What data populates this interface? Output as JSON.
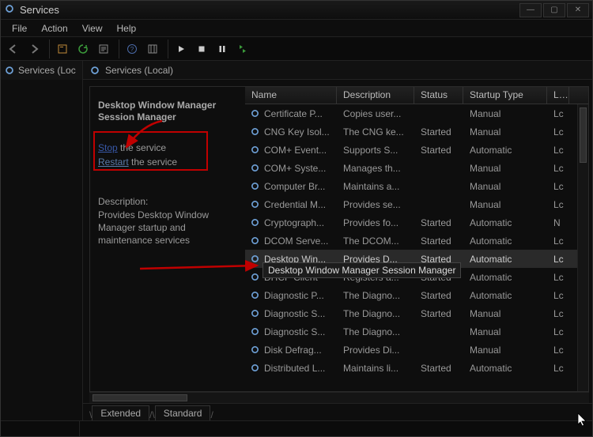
{
  "window": {
    "title": "Services"
  },
  "menu": {
    "file": "File",
    "action": "Action",
    "view": "View",
    "help": "Help"
  },
  "panes": {
    "left_header": "Services (Loc",
    "right_header": "Services (Local)"
  },
  "detail": {
    "service_name": "Desktop Window Manager Session Manager",
    "stop_link": "Stop",
    "stop_suffix": " the service",
    "restart_link": "Restart",
    "restart_suffix": " the service",
    "desc_label": "Description:",
    "desc_text": "Provides Desktop Window Manager startup and maintenance services"
  },
  "grid": {
    "headers": {
      "name": "Name",
      "desc": "Description",
      "status": "Status",
      "startup": "Startup Type",
      "logon": "Lo"
    },
    "rows": [
      {
        "name": "Certificate P...",
        "desc": "Copies user...",
        "status": "",
        "startup": "Manual",
        "logon": "Lc"
      },
      {
        "name": "CNG Key Isol...",
        "desc": "The CNG ke...",
        "status": "Started",
        "startup": "Manual",
        "logon": "Lc"
      },
      {
        "name": "COM+ Event...",
        "desc": "Supports S...",
        "status": "Started",
        "startup": "Automatic",
        "logon": "Lc"
      },
      {
        "name": "COM+ Syste...",
        "desc": "Manages th...",
        "status": "",
        "startup": "Manual",
        "logon": "Lc"
      },
      {
        "name": "Computer Br...",
        "desc": "Maintains a...",
        "status": "",
        "startup": "Manual",
        "logon": "Lc"
      },
      {
        "name": "Credential M...",
        "desc": "Provides se...",
        "status": "",
        "startup": "Manual",
        "logon": "Lc"
      },
      {
        "name": "Cryptograph...",
        "desc": "Provides fo...",
        "status": "Started",
        "startup": "Automatic",
        "logon": "N"
      },
      {
        "name": "DCOM Serve...",
        "desc": "The DCOM...",
        "status": "Started",
        "startup": "Automatic",
        "logon": "Lc"
      },
      {
        "name": "Desktop Win...",
        "desc": "Provides D...",
        "status": "Started",
        "startup": "Automatic",
        "logon": "Lc",
        "selected": true
      },
      {
        "name": "DHCP Client",
        "desc": "Registers a...",
        "status": "Started",
        "startup": "Automatic",
        "logon": "Lc"
      },
      {
        "name": "Diagnostic P...",
        "desc": "The Diagno...",
        "status": "Started",
        "startup": "Automatic",
        "logon": "Lc"
      },
      {
        "name": "Diagnostic S...",
        "desc": "The Diagno...",
        "status": "Started",
        "startup": "Manual",
        "logon": "Lc"
      },
      {
        "name": "Diagnostic S...",
        "desc": "The Diagno...",
        "status": "",
        "startup": "Manual",
        "logon": "Lc"
      },
      {
        "name": "Disk Defrag...",
        "desc": "Provides Di...",
        "status": "",
        "startup": "Manual",
        "logon": "Lc"
      },
      {
        "name": "Distributed L...",
        "desc": "Maintains li...",
        "status": "Started",
        "startup": "Automatic",
        "logon": "Lc"
      }
    ]
  },
  "tabs": {
    "extended": "Extended",
    "standard": "Standard"
  },
  "tooltip": "Desktop Window Manager Session Manager"
}
